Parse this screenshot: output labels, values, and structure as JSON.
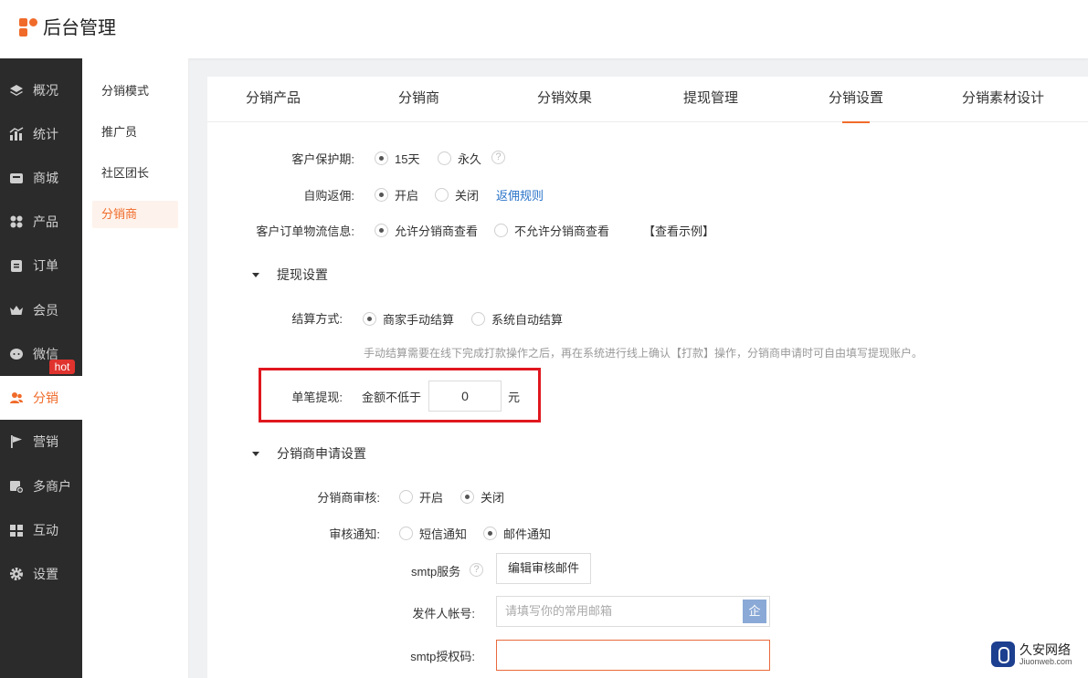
{
  "app": {
    "title": "后台管理"
  },
  "sidebar": {
    "items": [
      {
        "label": "概况",
        "icon": "layers-icon"
      },
      {
        "label": "统计",
        "icon": "chart-icon"
      },
      {
        "label": "商城",
        "icon": "store-icon"
      },
      {
        "label": "产品",
        "icon": "product-icon"
      },
      {
        "label": "订单",
        "icon": "order-icon"
      },
      {
        "label": "会员",
        "icon": "crown-icon"
      },
      {
        "label": "微信",
        "icon": "chat-icon"
      },
      {
        "label": "分销",
        "icon": "users-icon",
        "active": true
      },
      {
        "label": "营销",
        "icon": "flag-icon"
      },
      {
        "label": "多商户",
        "icon": "multi-store-icon"
      },
      {
        "label": "互动",
        "icon": "interact-icon"
      },
      {
        "label": "设置",
        "icon": "gear-icon"
      }
    ],
    "hot_badge": "hot"
  },
  "subnav": {
    "items": [
      {
        "label": "分销模式"
      },
      {
        "label": "推广员"
      },
      {
        "label": "社区团长"
      },
      {
        "label": "分销商",
        "active": true
      }
    ]
  },
  "tabs": [
    {
      "label": "分销产品"
    },
    {
      "label": "分销商"
    },
    {
      "label": "分销效果"
    },
    {
      "label": "提现管理"
    },
    {
      "label": "分销设置",
      "active": true
    },
    {
      "label": "分销素材设计"
    }
  ],
  "form": {
    "protection": {
      "label": "客户保护期:",
      "opt1": "15天",
      "opt2": "永久",
      "selected": "15天",
      "help": "?"
    },
    "self_rebate": {
      "label": "自购返佣:",
      "opt1": "开启",
      "opt2": "关闭",
      "selected": "开启",
      "link": "返佣规则"
    },
    "logistics": {
      "label": "客户订单物流信息:",
      "opt1": "允许分销商查看",
      "opt2": "不允许分销商查看",
      "selected": "允许分销商查看",
      "link": "【查看示例】"
    },
    "withdraw_section": {
      "title": "提现设置"
    },
    "settlement": {
      "label": "结算方式:",
      "opt1": "商家手动结算",
      "opt2": "系统自动结算",
      "selected": "商家手动结算",
      "hint": "手动结算需要在线下完成打款操作之后，再在系统进行线上确认【打款】操作，分销商申请时可自由填写提现账户。"
    },
    "single_withdraw": {
      "label": "单笔提现:",
      "prefix": "金额不低于",
      "value": "0",
      "unit": "元"
    },
    "apply_section": {
      "title": "分销商申请设置"
    },
    "review": {
      "label": "分销商审核:",
      "opt1": "开启",
      "opt2": "关闭",
      "selected": "关闭"
    },
    "review_notice": {
      "label": "审核通知:",
      "opt1": "短信通知",
      "opt2": "邮件通知",
      "selected": "邮件通知"
    },
    "smtp_service": {
      "label": "smtp服务",
      "help": "?",
      "button": "编辑审核邮件"
    },
    "sender": {
      "label": "发件人帐号:",
      "placeholder": "请填写你的常用邮箱",
      "icon_char": "企"
    },
    "smtp_code": {
      "label": "smtp授权码:",
      "value": ""
    }
  },
  "watermark": {
    "name": "久安网络",
    "url": "Jiuonweb.com"
  },
  "colors": {
    "accent": "#f06b2a",
    "sidebar_bg": "#2b2b2b",
    "highlight": "#e0171f",
    "link": "#2a73c9"
  }
}
